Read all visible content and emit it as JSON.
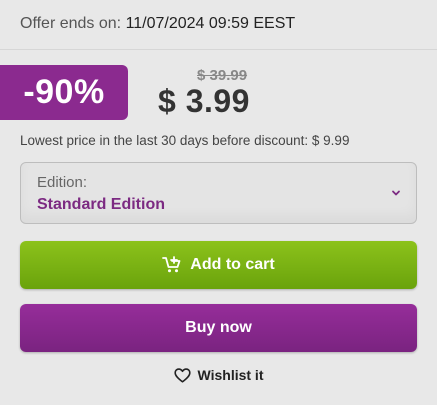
{
  "offer": {
    "prefix": "Offer ends on:",
    "date": "11/07/2024 09:59 EEST"
  },
  "pricing": {
    "discount": "-90%",
    "old_price": "$ 39.99",
    "new_price": "$ 3.99",
    "lowest_price_note": "Lowest price in the last 30 days before discount: $ 9.99"
  },
  "edition": {
    "label": "Edition:",
    "selected": "Standard Edition",
    "icon": "chevron-down-icon"
  },
  "actions": {
    "add_to_cart": "Add to cart",
    "add_to_cart_icon": "cart-plus-icon",
    "buy_now": "Buy now",
    "wishlist": "Wishlist it",
    "wishlist_icon": "heart-icon"
  },
  "colors": {
    "accent": "#8b2a8f",
    "cart_button": "#7bb312",
    "buy_button": "#8a2a8e",
    "edition_value": "#7c2a82"
  }
}
